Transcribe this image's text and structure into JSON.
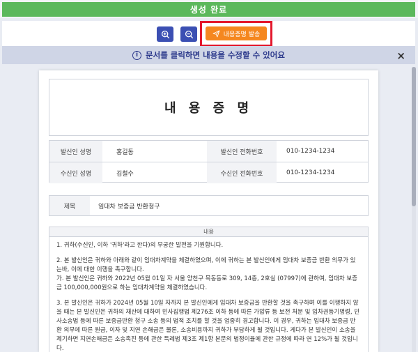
{
  "banner": {
    "text": "생성 완료"
  },
  "toolbar": {
    "zoom_in_icon": "zoom-in-icon",
    "zoom_out_icon": "zoom-out-icon",
    "send_label": "내용증명 발송",
    "send_icon": "paper-plane-icon"
  },
  "colors": {
    "banner": "#5cb85c",
    "zoom_button": "#3b4fb3",
    "send_button": "#f5871f",
    "highlight": "#e3182d",
    "notice_bg": "#cfd5e6"
  },
  "notice": {
    "text": "문서를 클릭하면 내용을 수정할 수 있어요",
    "info_icon": "i",
    "close_icon": "×"
  },
  "document": {
    "title": "내 용 증 명",
    "sender_name_label": "발신인 성명",
    "sender_name": "홍길동",
    "sender_phone_label": "발신인 전화번호",
    "sender_phone": "010-1234-1234",
    "receiver_name_label": "수신인 성명",
    "receiver_name": "김철수",
    "receiver_phone_label": "수신인 전화번호",
    "receiver_phone": "010-1234-1234",
    "subject_label": "제목",
    "subject": "임대차 보증금 반환청구",
    "content_label": "내용",
    "paragraphs": [
      "1. 귀하(수신인, 이하 '귀하'라고 한다)의 무궁한 발전을 기원합니다.",
      "2. 본 발신인은 귀하와 아래와 같이 임대차계약을 체결하였으며, 이에 귀하는 본 발신인에게 임대차 보증금 반환 의무가 있는바, 이에 대한 이행을 촉구합니다.\n가. 본 발신인은 귀하와 2022년 05월 01일 자 서울 양천구 목동동로 309, 14층, 2호실 (07997)에 관하여, 임대차 보증금 100,000,000원으로 하는 임대차계약을 체결하였습니다.",
      "3. 본 발신인은 귀하가 2024년 05월 10일 자까지 본 발신인에게 임대차 보증금을 반환할 것을 촉구하며 이를 이행하지 않을 때는 본 발신인은 귀하의 재산에 대하여 민사집행법 제276조 이하 등에 따른 가압류 등 보전 처분 및 임차권등기명령, 민사소송법 등에 따른 보증금반환 청구 소송 등의 법적 조치를 할 것을 엄중히 경고합니다. 이 경우, 귀하는 임대차 보증금 반환 의무에 따른 원금, 이자 및 지연 손해금은 물론, 소송비용까지 귀하가 부담하게 될 것입니다. 게다가 본 발신인이 소송을 제기하면 지연손해금은 소송촉진 등에 관한 특례법 제3조 제1항 본문의 법정이율에 관한 규정에 따라 연 12%가 될 것입니다."
    ]
  }
}
